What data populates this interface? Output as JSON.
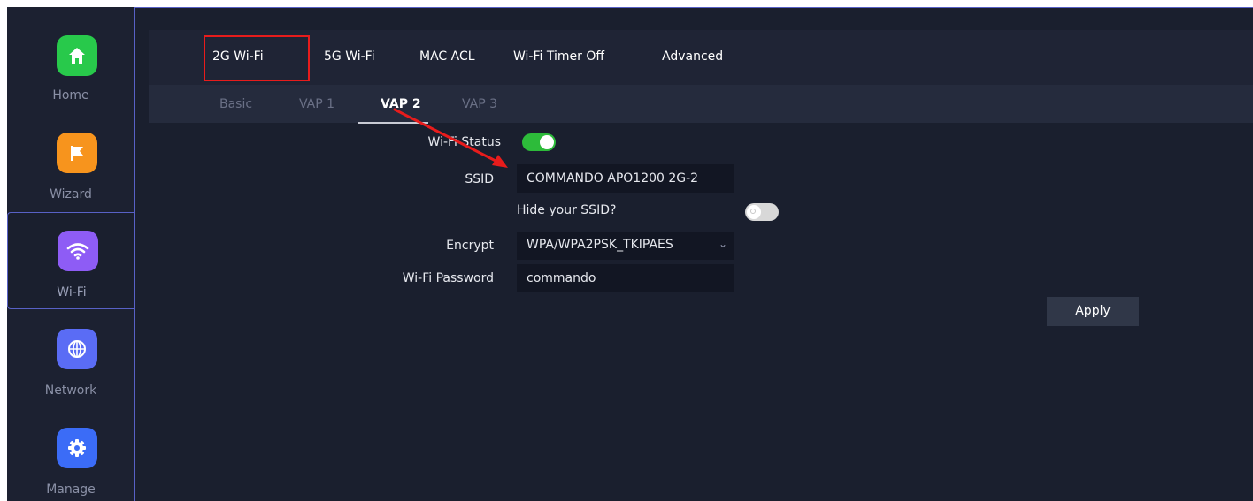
{
  "sidebar": {
    "items": [
      {
        "label": "Home",
        "icon": "home-icon",
        "color": "#28c94b"
      },
      {
        "label": "Wizard",
        "icon": "flag-icon",
        "color": "#f7941d"
      },
      {
        "label": "Wi-Fi",
        "icon": "wifi-icon",
        "color": "#8e5cf5",
        "active": true
      },
      {
        "label": "Network",
        "icon": "globe-icon",
        "color": "#5a6cf5"
      },
      {
        "label": "Manage",
        "icon": "gear-icon",
        "color": "#3b6cf7"
      }
    ]
  },
  "tabs": {
    "items": [
      "2G Wi-Fi",
      "5G Wi-Fi",
      "MAC ACL",
      "Wi-Fi Timer Off",
      "Advanced"
    ],
    "selected": "2G Wi-Fi"
  },
  "subtabs": {
    "items": [
      "Basic",
      "VAP 1",
      "VAP 2",
      "VAP 3"
    ],
    "selected": "VAP 2"
  },
  "form": {
    "wifi_status_label": "Wi-Fi Status",
    "wifi_status_on": true,
    "ssid_label": "SSID",
    "ssid_value": "COMMANDO APO1200 2G-2",
    "hide_ssid_label": "Hide your SSID?",
    "hide_ssid_on": false,
    "encrypt_label": "Encrypt",
    "encrypt_value": "WPA/WPA2PSK_TKIPAES",
    "password_label": "Wi-Fi Password",
    "password_value": "commando",
    "apply_label": "Apply"
  },
  "colors": {
    "accent_border": "#5861c6",
    "toggle_on": "#2dbb3a",
    "annotation_red": "#e81c1c"
  }
}
